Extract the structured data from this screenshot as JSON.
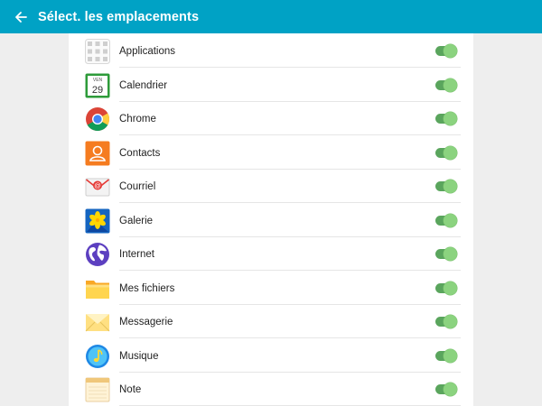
{
  "header": {
    "title": "Sélect. les emplacements",
    "back_icon": "arrow-left-icon"
  },
  "colors": {
    "appbar": "#00a2c5",
    "toggle_on": "#8bd37f",
    "toggle_track": "#5aa55d"
  },
  "items": [
    {
      "label": "Applications",
      "icon": "apps-grid-icon",
      "enabled": true
    },
    {
      "label": "Calendrier",
      "icon": "calendar-icon",
      "icon_text_top": "VEN",
      "icon_text_day": "29",
      "enabled": true
    },
    {
      "label": "Chrome",
      "icon": "chrome-icon",
      "enabled": true
    },
    {
      "label": "Contacts",
      "icon": "contacts-icon",
      "enabled": true
    },
    {
      "label": "Courriel",
      "icon": "email-icon",
      "enabled": true
    },
    {
      "label": "Galerie",
      "icon": "gallery-icon",
      "enabled": true
    },
    {
      "label": "Internet",
      "icon": "internet-globe-icon",
      "enabled": true
    },
    {
      "label": "Mes fichiers",
      "icon": "folder-icon",
      "enabled": true
    },
    {
      "label": "Messagerie",
      "icon": "messages-envelope-icon",
      "enabled": true
    },
    {
      "label": "Musique",
      "icon": "music-note-icon",
      "enabled": true
    },
    {
      "label": "Note",
      "icon": "notepad-icon",
      "enabled": true
    }
  ]
}
